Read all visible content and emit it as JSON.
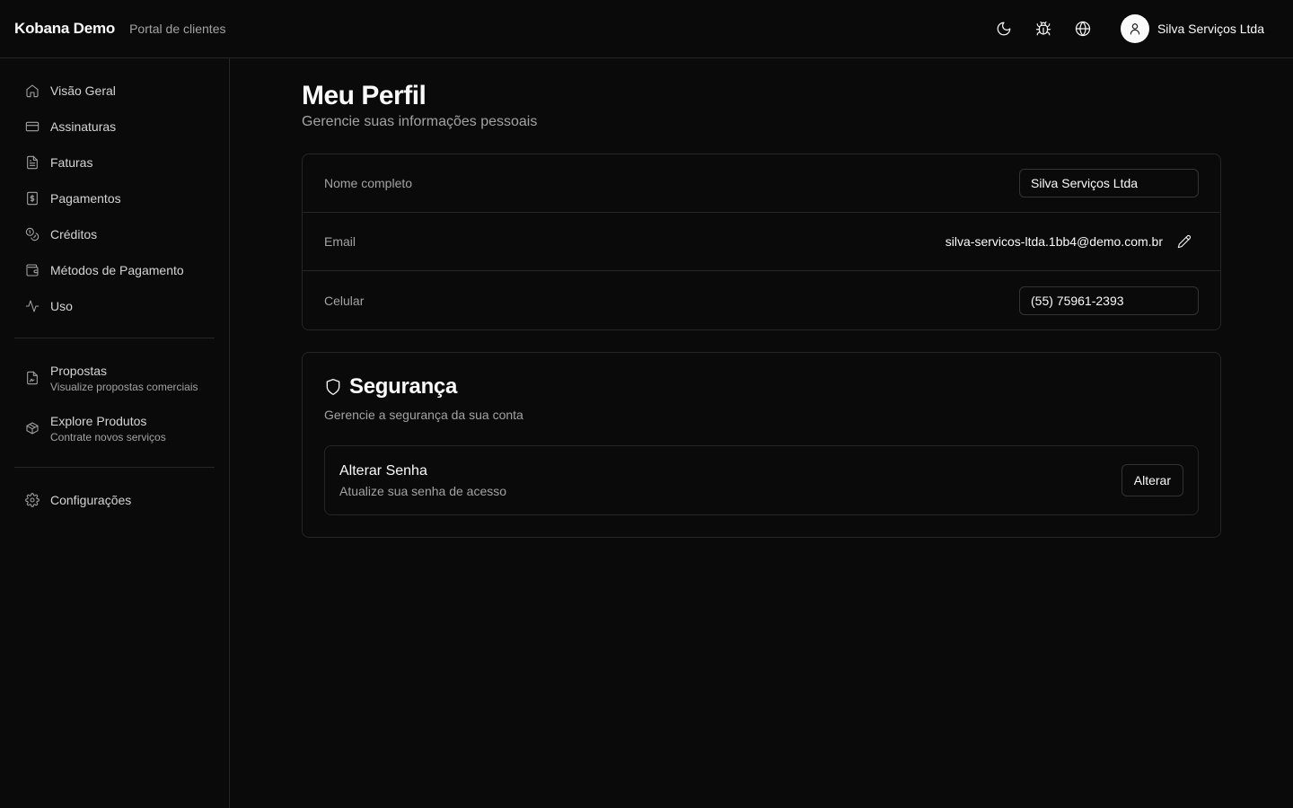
{
  "header": {
    "brand": "Kobana Demo",
    "subtitle": "Portal de clientes",
    "user_name": "Silva Serviços Ltda",
    "icons": [
      "moon-icon",
      "bug-icon",
      "globe-icon",
      "user-icon"
    ]
  },
  "sidebar": {
    "items": [
      {
        "label": "Visão Geral",
        "icon": "home-icon"
      },
      {
        "label": "Assinaturas",
        "icon": "credit-card-icon"
      },
      {
        "label": "Faturas",
        "icon": "file-text-icon"
      },
      {
        "label": "Pagamentos",
        "icon": "receipt-dollar-icon"
      },
      {
        "label": "Créditos",
        "icon": "coins-icon"
      },
      {
        "label": "Métodos de Pagamento",
        "icon": "wallet-icon"
      },
      {
        "label": "Uso",
        "icon": "activity-icon"
      }
    ],
    "extras": [
      {
        "label": "Propostas",
        "sub": "Visualize propostas comerciais",
        "icon": "file-signature-icon"
      },
      {
        "label": "Explore Produtos",
        "sub": "Contrate novos serviços",
        "icon": "package-icon"
      }
    ],
    "settings": {
      "label": "Configurações",
      "icon": "settings-icon"
    }
  },
  "main": {
    "title": "Meu Perfil",
    "description": "Gerencie suas informações pessoais",
    "profile": {
      "name_label": "Nome completo",
      "name_value": "Silva Serviços Ltda",
      "email_label": "Email",
      "email_value": "silva-servicos-ltda.1bb4@demo.com.br",
      "phone_label": "Celular",
      "phone_value": "(55) 75961-2393"
    },
    "security": {
      "title": "Segurança",
      "description": "Gerencie a segurança da sua conta",
      "password_title": "Alterar Senha",
      "password_desc": "Atualize sua senha de acesso",
      "button": "Alterar"
    }
  },
  "colors": {
    "background": "#0a0a0a",
    "border": "#262626",
    "text": "#fafafa",
    "muted": "#a3a3a3"
  }
}
